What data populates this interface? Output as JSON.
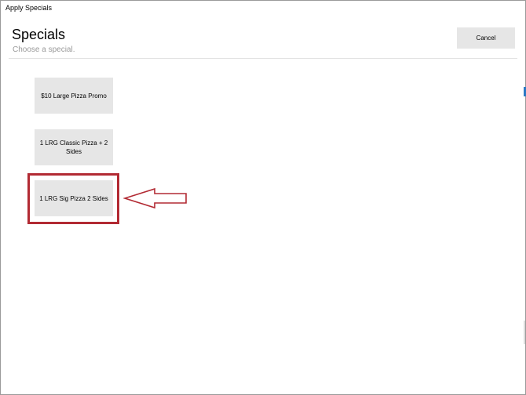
{
  "window": {
    "title": "Apply Specials"
  },
  "header": {
    "title": "Specials",
    "subtitle": "Choose a special.",
    "cancel_label": "Cancel"
  },
  "specials": [
    {
      "label": "$10 Large Pizza Promo"
    },
    {
      "label": "1 LRG Classic Pizza + 2 Sides"
    },
    {
      "label": "1 LRG Sig Pizza 2 Sides"
    }
  ],
  "annotation": {
    "highlight_color": "#b22a33",
    "highlighted_item": 2,
    "icon": "left-arrow-icon"
  },
  "colors": {
    "button_bg": "#e6e6e6",
    "accent": "#2b78c4",
    "subtitle": "#9a9a9a"
  }
}
